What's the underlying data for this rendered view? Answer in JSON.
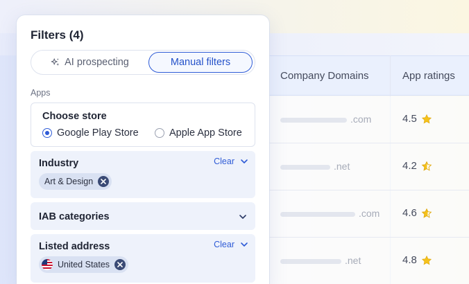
{
  "filters": {
    "title": "Filters (4)",
    "tabs": {
      "ai_label": "AI prospecting",
      "manual_label": "Manual filters"
    },
    "apps_label": "Apps",
    "store": {
      "title": "Choose store",
      "options": [
        "Google Play Store",
        "Apple App Store"
      ],
      "selected": "Google Play Store"
    },
    "industry": {
      "title": "Industry",
      "clear_label": "Clear",
      "chip": "Art & Design"
    },
    "iab": {
      "title": "IAB categories"
    },
    "address": {
      "title": "Listed address",
      "clear_label": "Clear",
      "chip": "United States"
    }
  },
  "table": {
    "columns": [
      "Company Domains",
      "App ratings"
    ],
    "rows": [
      {
        "tld": ".com",
        "rating": "4.5"
      },
      {
        "tld": ".net",
        "rating": "4.2"
      },
      {
        "tld": ".com",
        "rating": "4.6"
      },
      {
        "tld": ".net",
        "rating": "4.8"
      }
    ]
  },
  "colors": {
    "accent": "#2e5bd6",
    "star": "#f5c21b",
    "chip_bg": "#d9e1f2",
    "section_bg": "#eef2fb"
  },
  "icons": [
    "sparkle-icon",
    "star-icon",
    "chevron-down-icon",
    "close-icon",
    "us-flag-icon"
  ]
}
